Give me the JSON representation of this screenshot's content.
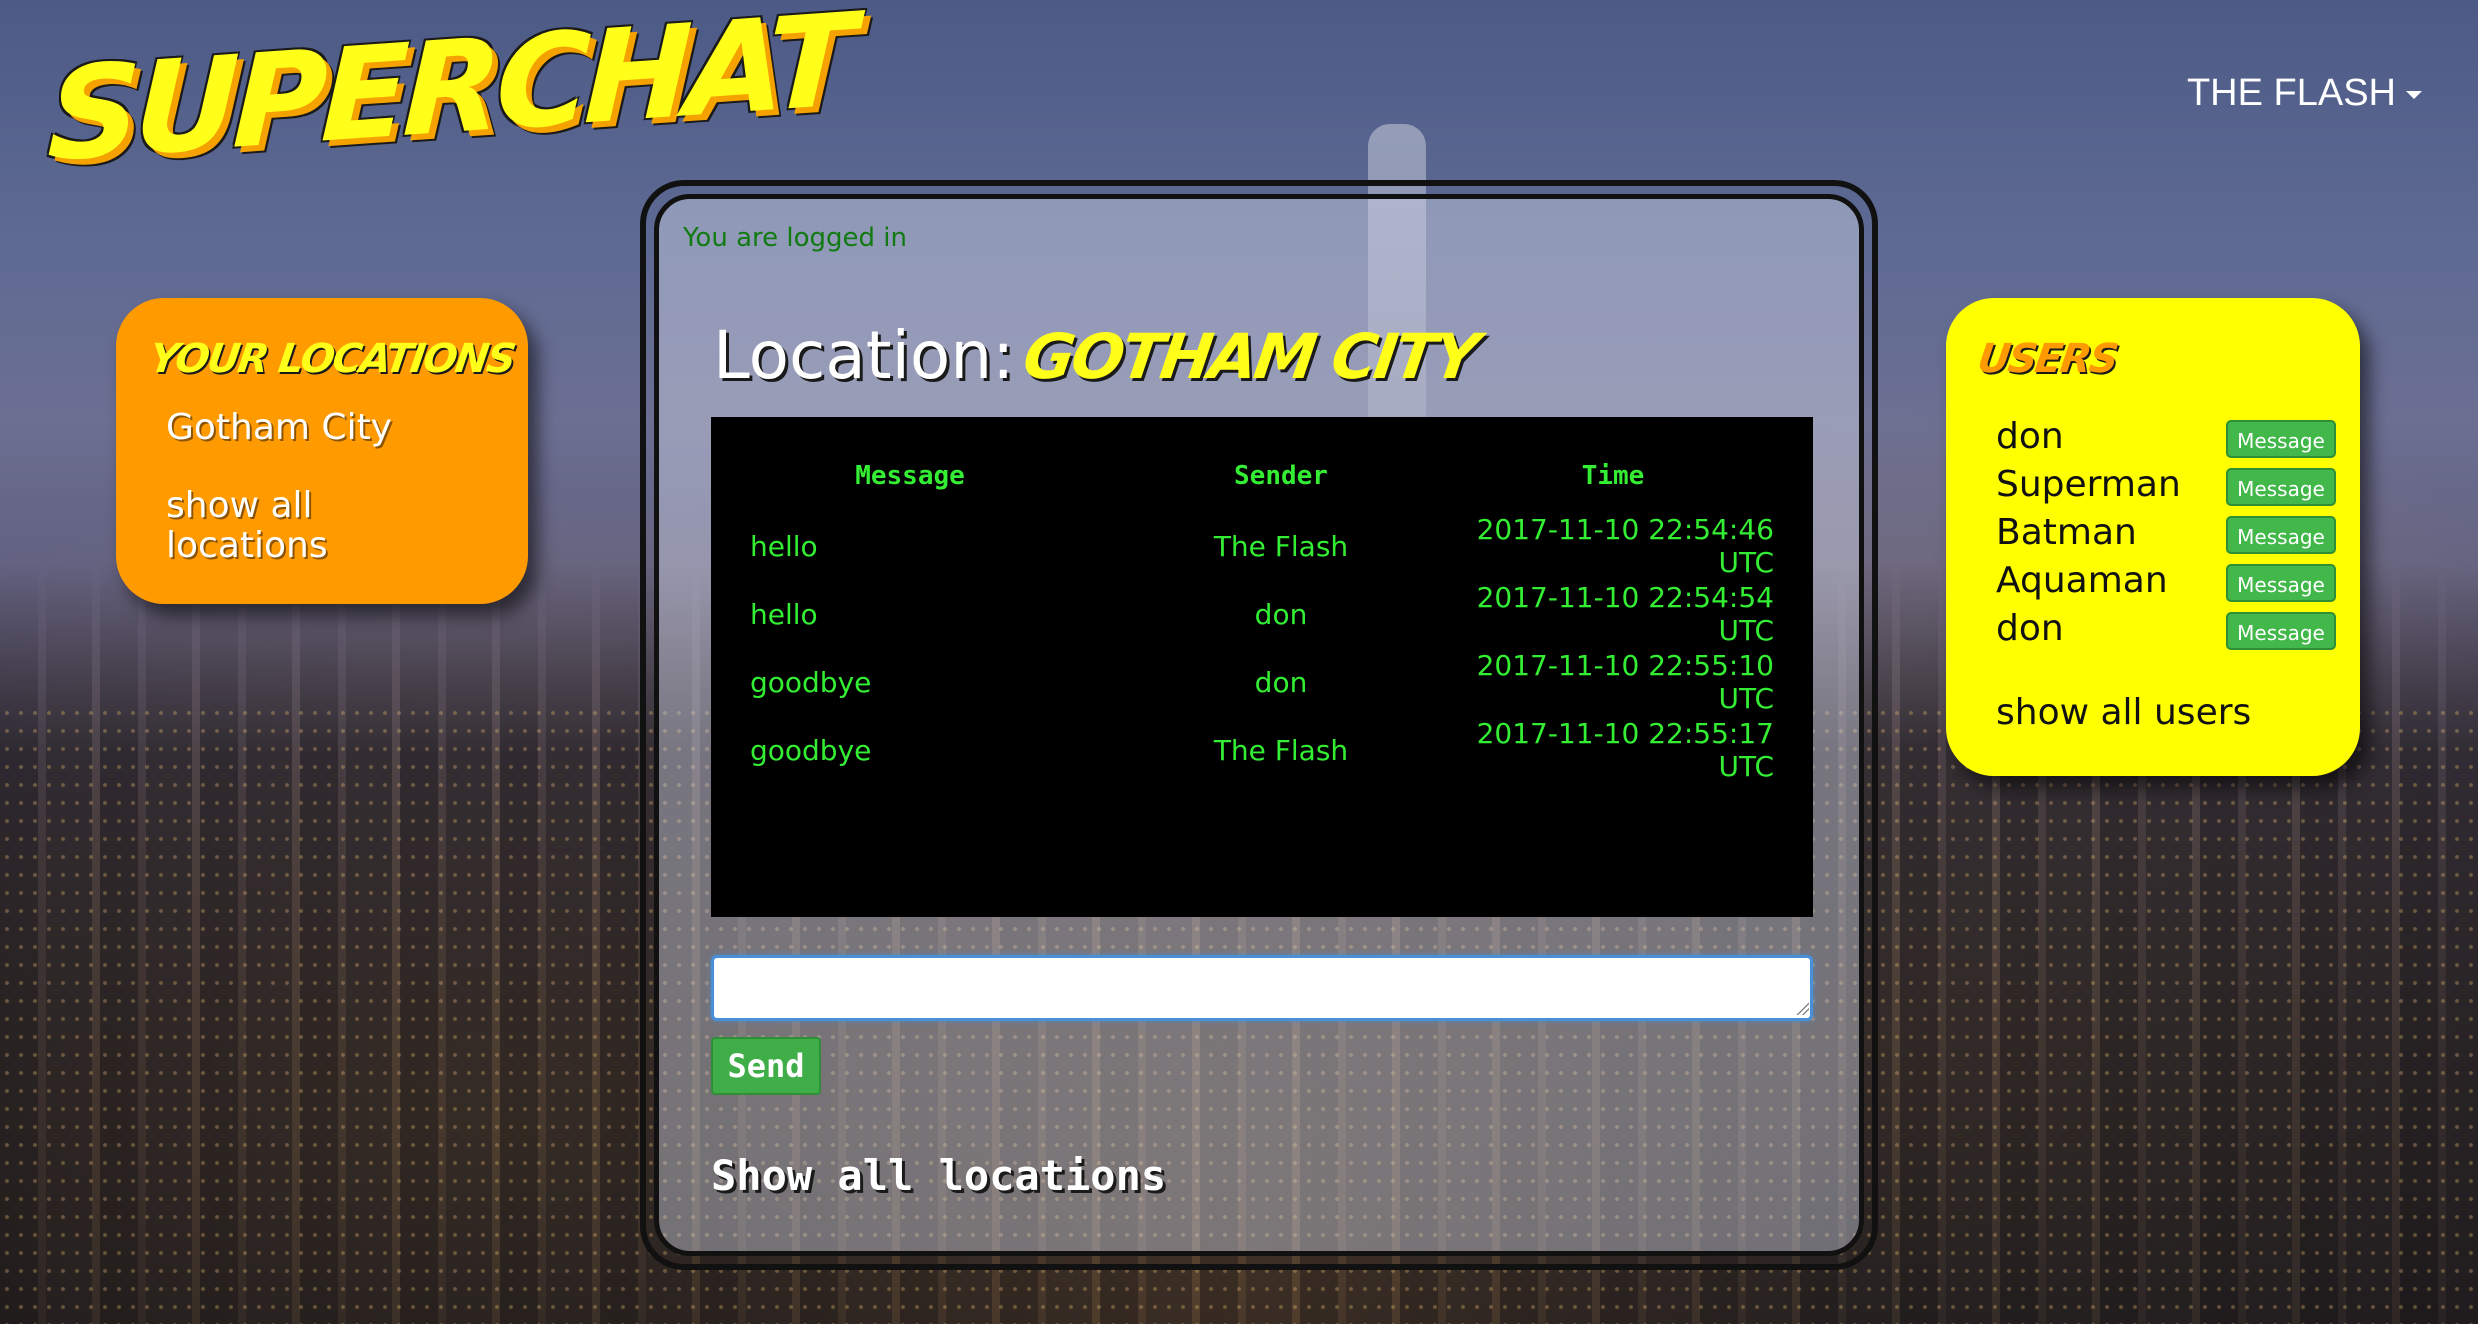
{
  "app": {
    "logo_text": "SUPERCHAT",
    "user_menu_label": "THE FLASH"
  },
  "locations_panel": {
    "title": "YOUR LOCATIONS",
    "items": [
      {
        "label": "Gotham City"
      },
      {
        "label": "show all locations"
      }
    ]
  },
  "main": {
    "status_text": "You are logged in",
    "location_label": "Location:",
    "location_name": "GOTHAM CITY",
    "chat": {
      "columns": [
        "Message",
        "Sender",
        "Time"
      ],
      "rows": [
        {
          "message": "hello",
          "sender": "The Flash",
          "time": "2017-11-10 22:54:46 UTC"
        },
        {
          "message": "hello",
          "sender": "don",
          "time": "2017-11-10 22:54:54 UTC"
        },
        {
          "message": "goodbye",
          "sender": "don",
          "time": "2017-11-10 22:55:10 UTC"
        },
        {
          "message": "goodbye",
          "sender": "The Flash",
          "time": "2017-11-10 22:55:17 UTC"
        }
      ]
    },
    "message_input_value": "",
    "send_label": "Send",
    "show_all_locations_label": "Show all locations"
  },
  "users_panel": {
    "title": "USERS",
    "users": [
      {
        "name": "don",
        "button_label": "Message"
      },
      {
        "name": "Superman",
        "button_label": "Message"
      },
      {
        "name": "Batman",
        "button_label": "Message"
      },
      {
        "name": "Aquaman",
        "button_label": "Message"
      },
      {
        "name": "don",
        "button_label": "Message"
      }
    ],
    "show_all_label": "show all users"
  },
  "colors": {
    "locations_card": "#ff9a00",
    "users_card": "#ffff00",
    "chat_text": "#33ee33",
    "button_green": "#42b84a",
    "logo_yellow": "#ffff1a",
    "status_green": "#127a12"
  },
  "icons": {
    "user_menu_caret": "caret-down-icon"
  }
}
